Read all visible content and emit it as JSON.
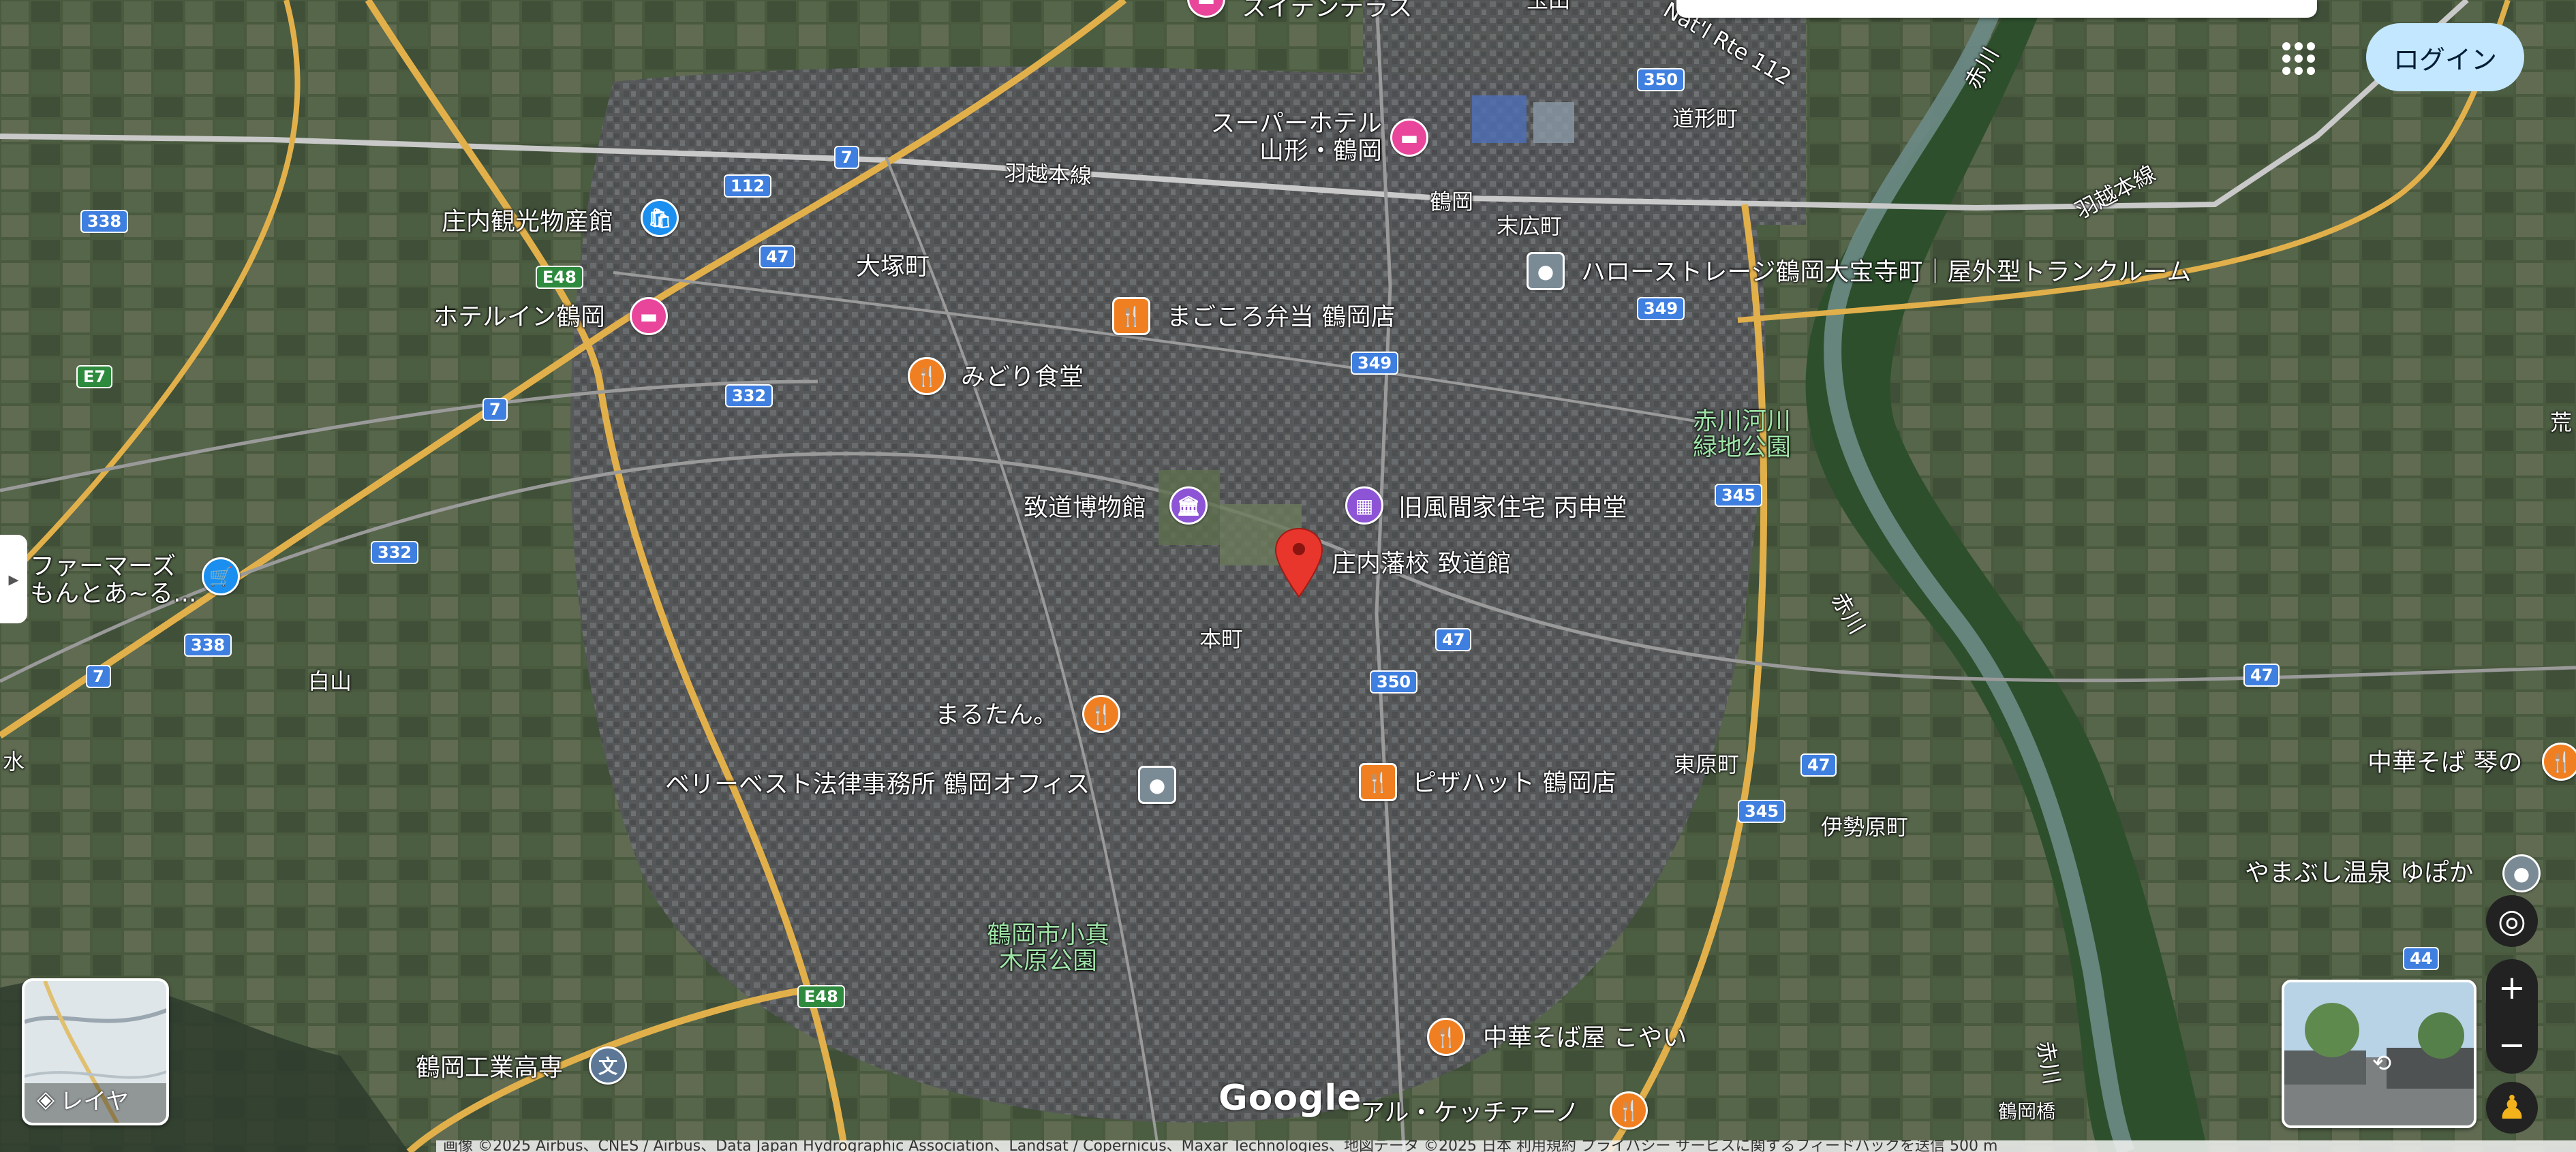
{
  "header": {
    "login_label": "ログイン"
  },
  "layers": {
    "label": "レイヤ"
  },
  "branding": {
    "logo": "Google"
  },
  "footer": {
    "attribution": "画像 ©2025 Airbus、CNES / Airbus、Data Japan Hydrographic Association、Landsat / Copernicus、Maxar Technologies、地図データ ©2025   日本   利用規約   プライバシー   サービスに関するフィードバックを送信   500 m"
  },
  "pin": {
    "label": "庄内藩校 致道館",
    "color": "#e8362c"
  },
  "places": {
    "suite_terrace": "スイテンテラス",
    "super_hotel": "スーパーホテル\n山形・鶴岡",
    "shonai_kanko": "庄内観光物産館",
    "hotel_inn": "ホテルイン鶴岡",
    "magokoro": "まごころ弁当 鶴岡店",
    "midori": "みどり食堂",
    "hello_storage": "ハローストレージ鶴岡大宝寺町｜屋外型トランクルーム",
    "chido_museum": "致道博物館",
    "kazama": "旧風間家住宅 丙申堂",
    "farmers": "ファーマーズ\nもんとあ~る...",
    "marutan": "まるたん。",
    "berry_best": "ベリーベスト法律事務所 鶴岡オフィス",
    "pizza_hut": "ピザハット 鶴岡店",
    "chuka_kotoya": "中華そば 琴の",
    "yamabushi": "やまぶし温泉 ゆぽか",
    "chuka_koyai": "中華そば屋 こやい",
    "al_che": "アル・ケッチァーノ",
    "kosen": "鶴岡工業高専"
  },
  "areas": {
    "otsuka": "大塚町",
    "tsuruoka_sta": "鶴岡",
    "suehiro": "末広町",
    "dogyo": "道形町",
    "honmachi": "本町",
    "shiroyama": "白山",
    "higashihara": "東原町",
    "iseharamachi": "伊勢原町",
    "akagawa_park": "赤川河川\n緑地公園",
    "komaki_park": "鶴岡市小真\n木原公園",
    "uetsu1": "羽越本線",
    "uetsu2": "羽越本線",
    "akagawa1": "赤川",
    "akagawa2": "赤川",
    "akagawa3": "赤川",
    "nat_rte": "Nat'l Rte 112",
    "tamada": "玉田",
    "mizu": "水",
    "ara": "荒",
    "tsuruokabashi": "鶴岡橋"
  },
  "routes": {
    "r338a": "338",
    "r338b": "338",
    "r112": "112",
    "r7a": "7",
    "r7b": "7",
    "r7c": "7",
    "r47a": "47",
    "r47b": "47",
    "r47c": "47",
    "r47d": "47",
    "r332a": "332",
    "r332b": "332",
    "r350a": "350",
    "r350b": "350",
    "r349a": "349",
    "r349b": "349",
    "r345a": "345",
    "r345b": "345",
    "r44": "44",
    "e48a": "E48",
    "e48b": "E48",
    "e7": "E7"
  },
  "colors": {
    "food": "#f07f21",
    "hotel": "#e8459b",
    "museum": "#8e54d6",
    "shop": "#1a8ff0",
    "generic": "#7b8b96",
    "school": "#5c7896"
  }
}
